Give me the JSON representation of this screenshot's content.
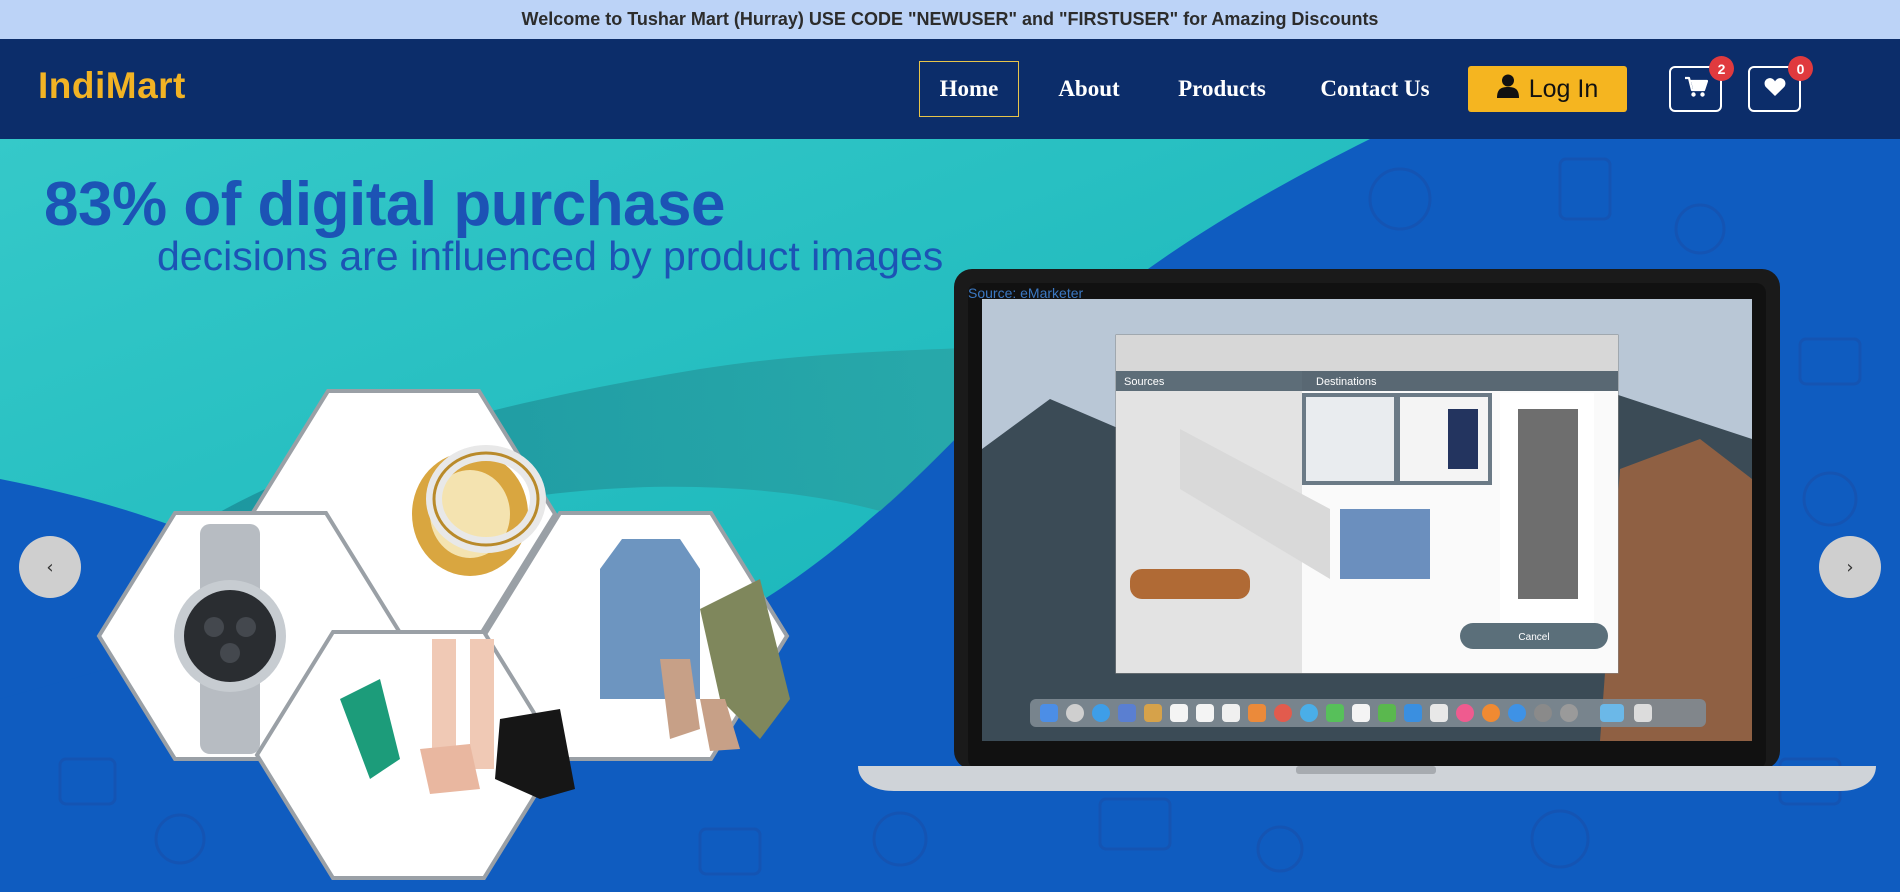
{
  "announcement": "Welcome to Tushar Mart (Hurray) USE CODE \"NEWUSER\" and \"FIRSTUSER\" for Amazing Discounts",
  "brand": "IndiMart",
  "nav": {
    "items": [
      {
        "label": "Home",
        "active": true
      },
      {
        "label": "About",
        "active": false
      },
      {
        "label": "Products",
        "active": false
      },
      {
        "label": "Contact Us",
        "active": false
      }
    ],
    "login_label": "Log In",
    "cart_count": "2",
    "wishlist_count": "0",
    "cart_icon": "cart-icon",
    "wishlist_icon": "heart-icon",
    "user_icon": "user-icon"
  },
  "hero": {
    "headline": "83% of digital purchase",
    "subline": "decisions are influenced by product images",
    "source": "Source: eMarketer",
    "prev_label": "‹",
    "next_label": "›",
    "app_window": {
      "sources_label": "Sources",
      "destinations_label": "Destinations",
      "cancel_label": "Cancel"
    }
  },
  "colors": {
    "announce_bg": "#bcd3f7",
    "nav_bg": "#0c2d6a",
    "brand": "#f2b324",
    "login_bg": "#f5b520",
    "badge": "#e03a3e",
    "hero_blue": "#0f5cc0",
    "hero_teal": "#20c3c3"
  }
}
